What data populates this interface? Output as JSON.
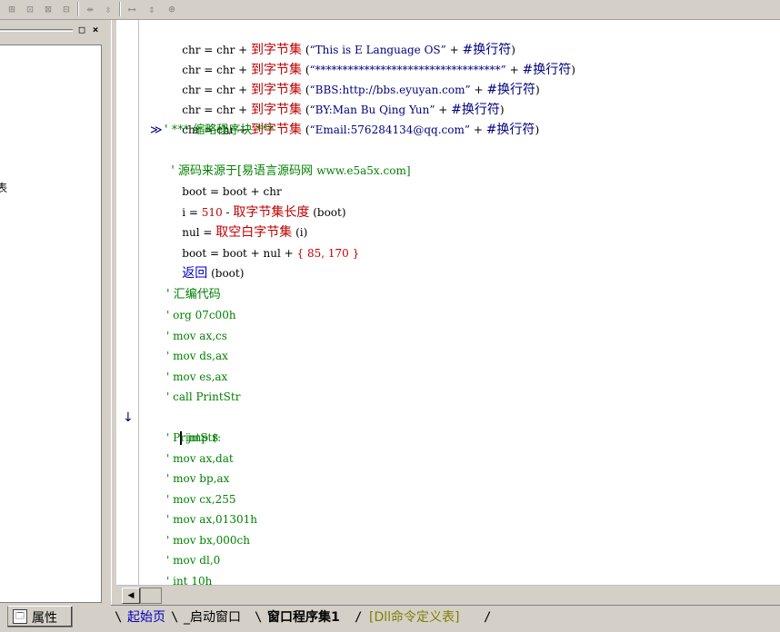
{
  "toolbar": {
    "icons": [
      "align-left-icon",
      "align-center-icon",
      "align-top-icon",
      "align-bottom-icon",
      "space-horizontal-icon",
      "space-vertical-icon",
      "width-icon",
      "height-icon",
      "size-icon"
    ],
    "glyphs": [
      "⊞",
      "⊡",
      "⊠",
      "⊟",
      "⇹",
      "⇳",
      "⟷",
      "⇕",
      "⊕"
    ]
  },
  "left_panel": {
    "fragment_text": "表",
    "minimize_label": "□",
    "close_label": "×"
  },
  "attr_tab": {
    "icon": "🗔",
    "label": "属性"
  },
  "gutter": {
    "breakpoint_arrow": "↓"
  },
  "code": {
    "line1": {
      "a": "chr",
      "b": " = ",
      "c": "chr",
      "d": " + ",
      "e": "到字节集",
      "f": " (",
      "g": "“This is E Language OS”",
      "h": " + ",
      "i": "#换行符",
      "j": ")"
    },
    "line2": {
      "a": "chr",
      "b": " = ",
      "c": "chr",
      "d": " + ",
      "e": "到字节集",
      "f": " (",
      "g": "“**********************************”",
      "h": " + ",
      "i": "#换行符",
      "j": ")"
    },
    "line3": {
      "a": "chr",
      "b": " = ",
      "c": "chr",
      "d": " + ",
      "e": "到字节集",
      "f": " (",
      "g": "“BBS:http://bbs.eyuyan.com”",
      "h": " + ",
      "i": "#换行符",
      "j": ")"
    },
    "line4": {
      "a": "chr",
      "b": " = ",
      "c": "chr",
      "d": " + ",
      "e": "到字节集",
      "f": " (",
      "g": "“BY:Man Bu Qing Yun”",
      "h": " + ",
      "i": "#换行符",
      "j": ")"
    },
    "line5": {
      "a": "chr",
      "b": " = ",
      "c": "chr",
      "d": " + ",
      "e": "到字节集",
      "f": " (",
      "g": "“Email:576284134@qq.com”",
      "h": " + ",
      "i": "#换行符",
      "j": ")"
    },
    "fold_marker": "≫",
    "line6": "' *** 缩略程序块 ***",
    "line7a": "' 源码来源于[易语言源码网 ",
    "line7b": "www.e5a5x.com]",
    "line8": {
      "a": "boot",
      "b": " = ",
      "c": "boot",
      "d": " + ",
      "e": "chr"
    },
    "line9": {
      "a": "i",
      "b": " = ",
      "c": "510",
      "d": " - ",
      "e": "取字节集长度",
      "f": " (boot)"
    },
    "line10": {
      "a": "nul",
      "b": " = ",
      "c": "取空白字节集",
      "d": " (i)"
    },
    "line11": {
      "a": "boot",
      "b": " = ",
      "c": "boot",
      "d": " + ",
      "e": "nul",
      "f": " + ",
      "g": "{ 85, 170 }"
    },
    "line12": {
      "a": "返回",
      "b": " (boot)"
    },
    "asm": [
      "' 汇编代码",
      "' org 07c00h",
      "' mov ax,cs",
      "' mov ds,ax",
      "' mov es,ax",
      "' call PrintStr",
      "jmp $",
      "' PrintStr:",
      "' mov ax,dat",
      "' mov bp,ax",
      "' mov cx,255",
      "' mov ax,01301h",
      "' mov bx,000ch",
      "' mov dl,0",
      "' int 10h"
    ]
  },
  "tabs": {
    "start": "起始页",
    "startup": "_启动窗口",
    "program": "窗口程序集1",
    "dll": "[Dll命令定义表]"
  }
}
